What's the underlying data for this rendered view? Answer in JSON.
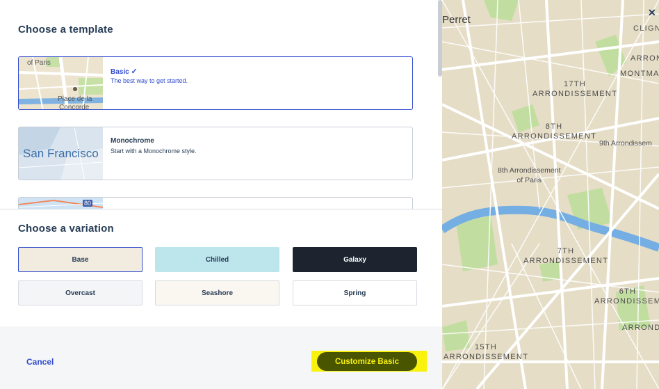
{
  "templates": {
    "title": "Choose a template",
    "items": [
      {
        "name": "Basic",
        "desc": "The best way to get started.",
        "thumb_text_1": "of Paris",
        "thumb_text_2": "Place de la",
        "thumb_text_3": "Concorde"
      },
      {
        "name": "Monochrome",
        "desc": "Start with a Monochrome style.",
        "thumb_text_1": "San Francisco"
      },
      {
        "name": "",
        "desc": "",
        "thumb_text_1": "80"
      }
    ]
  },
  "variations": {
    "title": "Choose a variation",
    "items": [
      {
        "label": "Base",
        "bg": "#f1ebe0",
        "color": "#273d56"
      },
      {
        "label": "Chilled",
        "bg": "#bde5ec",
        "color": "#273d56"
      },
      {
        "label": "Galaxy",
        "bg": "#1d2430",
        "color": "#ffffff"
      },
      {
        "label": "Overcast",
        "bg": "#f3f5f6",
        "color": "#273d56"
      },
      {
        "label": "Seashore",
        "bg": "#faf7f1",
        "color": "#273d56"
      },
      {
        "label": "Spring",
        "bg": "#ffffff",
        "color": "#273d56"
      }
    ]
  },
  "footer": {
    "cancel_label": "Cancel",
    "customize_label": "Customize Basic"
  },
  "map": {
    "labels": [
      "Perret",
      "CLIGN",
      "ARRON",
      "MONTMA",
      "17TH\nARRONDISSEMENT",
      "8TH\nARRONDISSEMENT",
      "9th Arrondissem",
      "8th Arrondissement\nof Paris",
      "7TH\nARRONDISSEMENT",
      "6TH\nARRONDISSEM",
      "ARROND",
      "15TH\nARRONDISSEMENT"
    ]
  },
  "colors": {
    "accent": "#314ccd",
    "text": "#273d56",
    "highlight": "#f8f20c",
    "map_land": "#e5ddc6",
    "map_water": "#74aee3",
    "map_park": "#c1dea0"
  }
}
